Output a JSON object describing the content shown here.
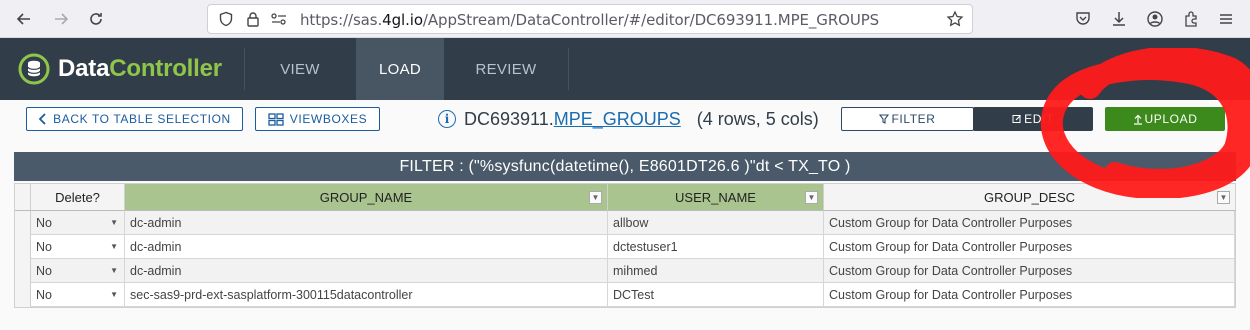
{
  "browser": {
    "url_prefix": "https://sas.",
    "url_domain": "4gl.io",
    "url_path": "/AppStream/DataController/#/editor/DC693911.MPE_GROUPS"
  },
  "app": {
    "logo_part1": "Data",
    "logo_part2": "Controller",
    "tabs": [
      {
        "label": "VIEW"
      },
      {
        "label": "LOAD"
      },
      {
        "label": "REVIEW"
      }
    ]
  },
  "toolbar": {
    "back_label": "BACK TO TABLE SELECTION",
    "viewboxes_label": "VIEWBOXES",
    "library": "DC693911.",
    "table": "MPE_GROUPS",
    "summary": "(4 rows, 5 cols)",
    "filter_label": "FILTER",
    "edit_label": "EDIT",
    "upload_label": "UPLOAD"
  },
  "filter": {
    "text": "FILTER : (\"%sysfunc(datetime(), E8601DT26.6 )\"dt < TX_TO )"
  },
  "grid": {
    "columns": [
      "Delete?",
      "GROUP_NAME",
      "USER_NAME",
      "GROUP_DESC"
    ],
    "rows": [
      {
        "delete": "No",
        "group_name": "dc-admin",
        "user_name": "allbow",
        "group_desc": "Custom Group for Data Controller Purposes"
      },
      {
        "delete": "No",
        "group_name": "dc-admin",
        "user_name": "dctestuser1",
        "group_desc": "Custom Group for Data Controller Purposes"
      },
      {
        "delete": "No",
        "group_name": "dc-admin",
        "user_name": "mihmed",
        "group_desc": "Custom Group for Data Controller Purposes"
      },
      {
        "delete": "No",
        "group_name": "sec-sas9-prd-ext-sasplatform-300115datacontroller",
        "user_name": "DCTest",
        "group_desc": "Custom Group for Data Controller Purposes"
      }
    ]
  },
  "colors": {
    "header_bg": "#313d48",
    "accent_green": "#8ec54a",
    "upload_green": "#3c8a1c",
    "link_blue": "#1a6cb0",
    "scribble_red": "#ff1a1a"
  }
}
